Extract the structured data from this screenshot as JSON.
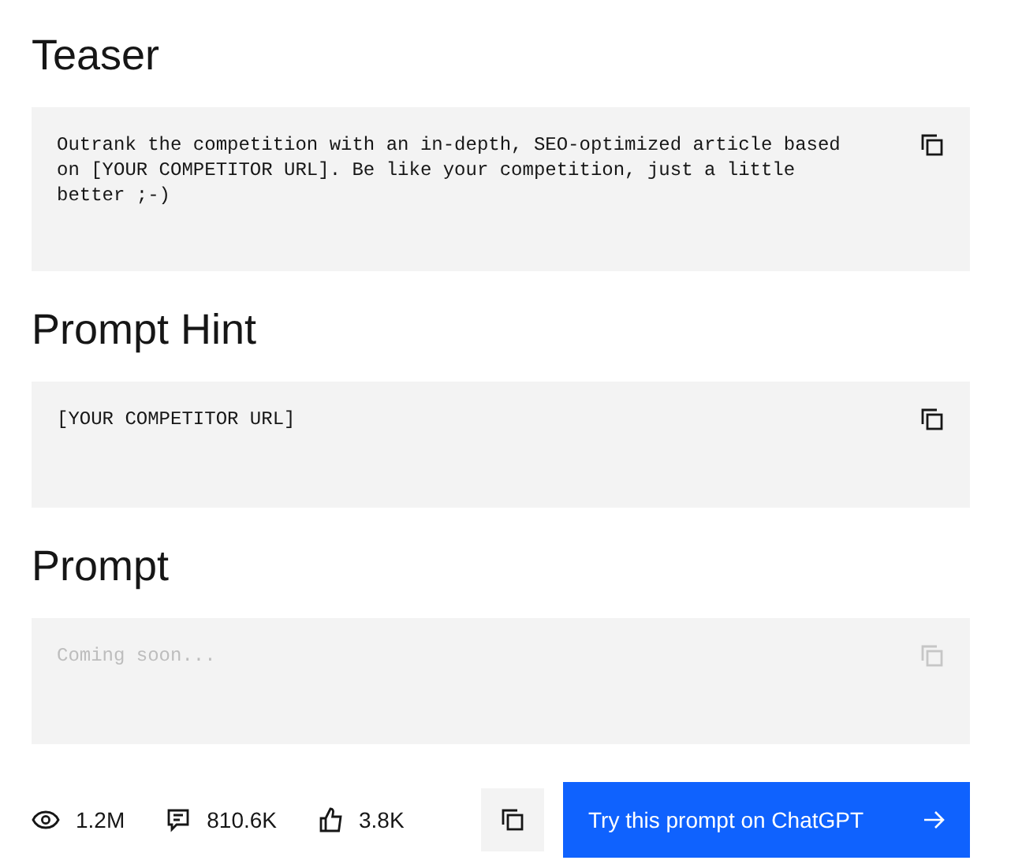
{
  "sections": [
    {
      "heading": "Teaser",
      "text": "Outrank the competition with an in-depth, SEO-optimized article based on [YOUR COMPETITOR URL]. Be like your competition, just a little better ;-)",
      "disabled": false
    },
    {
      "heading": "Prompt Hint",
      "text": "[YOUR COMPETITOR URL]",
      "disabled": false
    },
    {
      "heading": "Prompt",
      "placeholder": "Coming soon...",
      "disabled": true
    }
  ],
  "stats": [
    {
      "kind": "views",
      "value": "1.2M"
    },
    {
      "kind": "comments",
      "value": "810.6K"
    },
    {
      "kind": "likes",
      "value": "3.8K"
    }
  ],
  "try_button": "Try this prompt on ChatGPT"
}
